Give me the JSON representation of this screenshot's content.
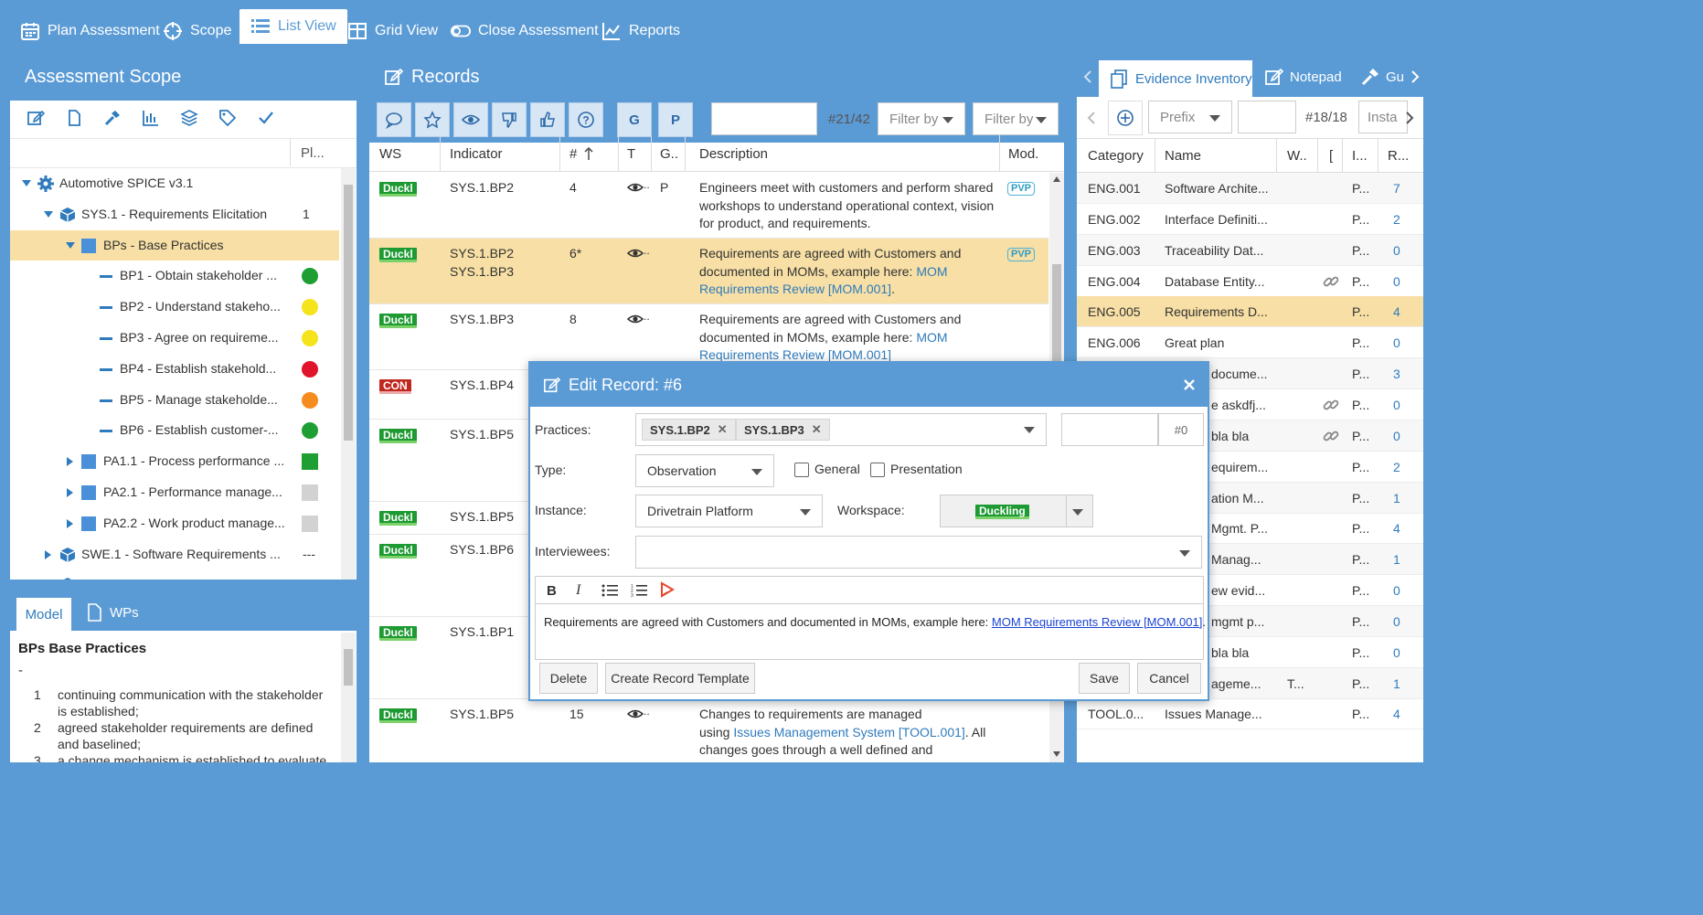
{
  "nav": {
    "plan": "Plan Assessment",
    "scope": "Scope",
    "list": "List View",
    "grid": "Grid View",
    "close": "Close Assessment",
    "reports": "Reports"
  },
  "scope": {
    "title": "Assessment Scope",
    "col_pl": "Pl...",
    "tree": [
      {
        "label": "Automotive SPICE v3.1",
        "value": ""
      },
      {
        "label": "SYS.1 - Requirements Elicitation",
        "value": "1"
      },
      {
        "label": "BPs - Base Practices",
        "value": ""
      },
      {
        "label": "BP1 - Obtain stakeholder ...",
        "value": ""
      },
      {
        "label": "BP2 - Understand stakeho...",
        "value": ""
      },
      {
        "label": "BP3 - Agree on requireme...",
        "value": ""
      },
      {
        "label": "BP4 - Establish stakehold...",
        "value": ""
      },
      {
        "label": "BP5 - Manage stakeholde...",
        "value": ""
      },
      {
        "label": "BP6 - Establish customer-...",
        "value": ""
      },
      {
        "label": "PA1.1 - Process performance ...",
        "value": ""
      },
      {
        "label": "PA2.1 - Performance manage...",
        "value": ""
      },
      {
        "label": "PA2.2 - Work product manage...",
        "value": ""
      },
      {
        "label": "SWE.1 - Software Requirements ...",
        "value": "---"
      },
      {
        "label": "SWE.2 - Software Architectural D...",
        "value": ""
      }
    ],
    "colors": {
      "green": "#1e9e33",
      "yellow": "#f5e31b",
      "red": "#e0142a",
      "orange": "#f68c1f",
      "grey": "#d2d2d2"
    }
  },
  "model": {
    "tab_model": "Model",
    "tab_wps": "WPs",
    "heading": "BPs Base Practices",
    "dash": "-",
    "items": [
      {
        "n": "1",
        "text": "continuing communication with the stakeholder",
        "text2": "is established;"
      },
      {
        "n": "2",
        "text": "agreed stakeholder requirements are defined",
        "text2": "and baselined;"
      },
      {
        "n": "3",
        "text": "a change mechanism is established to evaluate",
        "text2": ""
      }
    ]
  },
  "records": {
    "title": "Records",
    "count": "#21/42",
    "filter1": "Filter by",
    "filter2": "Filter by",
    "g": "G",
    "p": "P",
    "cols": {
      "ws": "WS",
      "indicator": "Indicator",
      "num": "#",
      "t": "T",
      "g": "G..",
      "desc": "Description",
      "mod": "Mod."
    },
    "rows": [
      {
        "tag": "Duckl",
        "ind1": "SYS.1.BP2",
        "ind2": "",
        "num": "4",
        "t": "P",
        "d1": "Engineers meet with customers and perform shared",
        "d2": "workshops to understand operational context, vision",
        "d3": "for product, and requirements.",
        "mod": "PVP"
      },
      {
        "tag": "Duckl",
        "ind1": "SYS.1.BP2",
        "ind2": "SYS.1.BP3",
        "num": "6*",
        "d1": "Requirements are agreed with Customers and",
        "d2pre": "documented in MOMs, example here: ",
        "d2link": "MOM",
        "d3link": "Requirements Review [MOM.001]",
        "d3post": ".",
        "mod": "PVP"
      },
      {
        "tag": "Duckl",
        "ind1": "SYS.1.BP3",
        "num": "8",
        "d1": "Requirements are agreed with Customers and",
        "d2pre": "documented in MOMs, example here: ",
        "d2link": "MOM",
        "d3link": "Requirements Review [MOM.001]"
      },
      {
        "tag": "CON",
        "ind1": "SYS.1.BP4"
      },
      {
        "tag": "Duckl",
        "ind1": "SYS.1.BP5"
      },
      {
        "tag": "Duckl",
        "ind1": "SYS.1.BP5"
      },
      {
        "tag": "Duckl",
        "ind1": "SYS.1.BP6"
      },
      {
        "tag": "Duckl",
        "ind1": "SYS.1.BP1"
      },
      {
        "tag": "Duckl",
        "ind1": "SYS.1.BP5",
        "num": "15",
        "d1": "Changes to requirements are managed",
        "d2pre": "using ",
        "d2link": "Issues Management System [TOOL.001]",
        "d2post": ". All",
        "d3": "changes goes through a well defined and"
      }
    ]
  },
  "evidence": {
    "tab1": "Evidence Inventory",
    "tab2": "Notepad",
    "tab3": "Gu",
    "prefix": "Prefix",
    "count": "#18/18",
    "insta": "Insta",
    "cols": {
      "cat": "Category",
      "name": "Name",
      "w": "W..",
      "d": "[",
      "i": "I...",
      "r": "R..."
    },
    "rows": [
      {
        "cat": "ENG.001",
        "name": "Software Archite...",
        "i": "P...",
        "r": "7"
      },
      {
        "cat": "ENG.002",
        "name": "Interface Definiti...",
        "i": "P...",
        "r": "2"
      },
      {
        "cat": "ENG.003",
        "name": "Traceability Dat...",
        "i": "P...",
        "r": "0"
      },
      {
        "cat": "ENG.004",
        "name": "Database Entity...",
        "i": "P...",
        "r": "0"
      },
      {
        "cat": "ENG.005",
        "name": "Requirements D...",
        "i": "P...",
        "r": "4"
      },
      {
        "cat": "ENG.006",
        "name": "Great plan",
        "i": "P...",
        "r": "0"
      },
      {
        "cat": "",
        "name": "docume...",
        "i": "P...",
        "r": "3"
      },
      {
        "cat": "",
        "name": "e askdfj...",
        "i": "P...",
        "r": "0"
      },
      {
        "cat": "",
        "name": "bla bla",
        "i": "P...",
        "r": "0"
      },
      {
        "cat": "",
        "name": "equirem...",
        "i": "P...",
        "r": "2"
      },
      {
        "cat": "",
        "name": "ation M...",
        "i": "P...",
        "r": "1"
      },
      {
        "cat": "",
        "name": "Mgmt. P...",
        "i": "P...",
        "r": "4"
      },
      {
        "cat": "",
        "name": "Manag...",
        "i": "P...",
        "r": "1"
      },
      {
        "cat": "",
        "name": "ew evid...",
        "i": "P...",
        "r": "0"
      },
      {
        "cat": "",
        "name": "mgmt p...",
        "i": "P...",
        "r": "0"
      },
      {
        "cat": "",
        "name": "bla bla",
        "i": "P...",
        "r": "0"
      },
      {
        "cat": "",
        "name": "ageme...",
        "w": "T...",
        "i": "P...",
        "r": "1"
      },
      {
        "cat": "TOOL.0...",
        "name": "Issues Manage...",
        "i": "P...",
        "r": "4"
      }
    ]
  },
  "dialog": {
    "title": "Edit Record: #6",
    "practices_label": "Practices:",
    "chip1": "SYS.1.BP2",
    "chip2": "SYS.1.BP3",
    "hash": "#0",
    "type_label": "Type:",
    "type_value": "Observation",
    "general": "General",
    "presentation": "Presentation",
    "instance_label": "Instance:",
    "instance_value": "Drivetrain Platform",
    "workspace_label": "Workspace:",
    "workspace_value": "Duckling",
    "interviewees_label": "Interviewees:",
    "body_text": "Requirements are agreed with Customers and documented in MOMs, example here: ",
    "body_link": "MOM Requirements Review [MOM.001]",
    "body_end": ".",
    "delete": "Delete",
    "template": "Create Record Template",
    "save": "Save",
    "cancel": "Cancel"
  }
}
